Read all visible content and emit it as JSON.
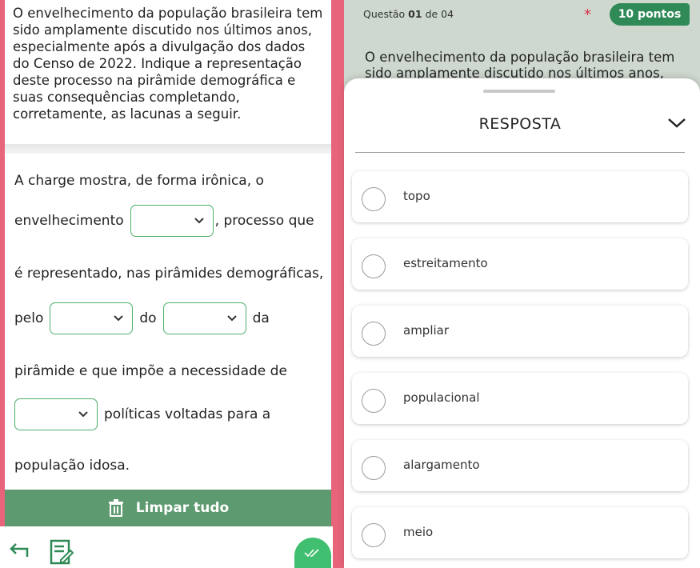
{
  "question": {
    "text": "O envelhecimento da população brasileira tem sido amplamente discutido nos últimos anos, especialmente após a divulgação dos dados do Censo de 2022. Indique a representação deste processo na pirâmide demográfica e suas consequências completando, corretamente, as lacunas a seguir."
  },
  "fill": {
    "line1": "A charge mostra, de forma irônica, o",
    "line2_a": "envelhecimento",
    "line2_b": ", processo que",
    "line3": "é representado, nas pirâmides demográficas,",
    "line4_a": "pelo",
    "line4_b": "do",
    "line4_c": "da",
    "line5": "pirâmide e que impõe a necessidade de",
    "line6": "políticas voltadas para a",
    "line7": "população idosa."
  },
  "clear_label": "Limpar tudo",
  "header": {
    "counter_prefix": "Questão",
    "counter_num": "01",
    "counter_suffix": "de 04",
    "asterisk": "*",
    "points": "10 pontos",
    "question_preview": "O envelhecimento da população brasileira tem sido amplamente discutido nos últimos anos,"
  },
  "response": {
    "title": "RESPOSTA",
    "options": [
      "topo",
      "estreitamento",
      "ampliar",
      "populacional",
      "alargamento",
      "meio"
    ]
  },
  "colors": {
    "accent_green": "#2f8a57",
    "clear_bar": "#5e9a6f",
    "frame_pink": "#e8647a",
    "check_green": "#3fbf6f"
  },
  "icons": {
    "back": "back-arrow-icon",
    "edit": "edit-notes-icon",
    "check": "double-check-icon",
    "trash": "trash-icon",
    "chevron": "chevron-down-icon"
  }
}
